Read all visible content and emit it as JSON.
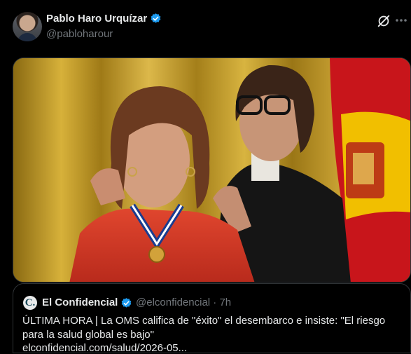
{
  "author": {
    "display_name": "Pablo Haro Urquízar",
    "handle": "@pabloharour"
  },
  "icons": {
    "verified": "verified-badge-icon",
    "grok": "grok-icon",
    "more": "more-options-icon"
  },
  "colors": {
    "background": "#000000",
    "verified_blue": "#1d9bf0",
    "secondary_text": "#71767b",
    "border": "#2f3336"
  },
  "quoted": {
    "avatar_letter": "C.",
    "display_name": "El Confidencial",
    "handle_time": "@elconfidencial · 7h",
    "text": "ÚLTIMA HORA | La OMS califica de \"éxito\" el desembarco e insiste: \"El riesgo para la salud global es bajo\"",
    "link": "elconfidencial.com/salud/2026-05..."
  }
}
